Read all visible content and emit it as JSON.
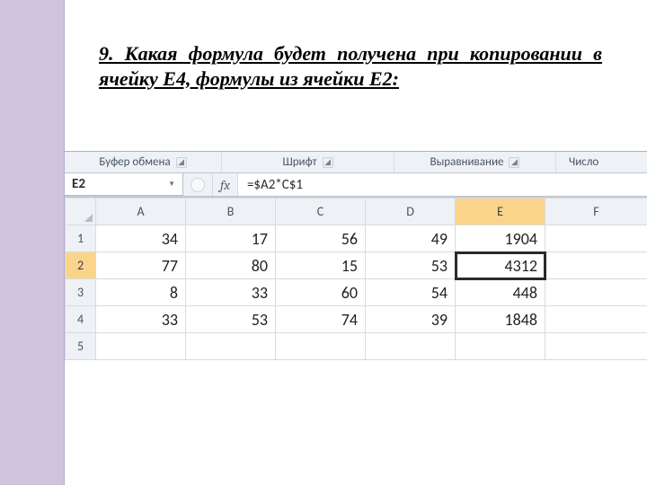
{
  "question": {
    "text": "9. Какая формула будет получена при копировании в ячейку Е4, формулы из ячейки Е2:"
  },
  "ribbon": {
    "groups": {
      "clipboard": "Буфер обмена",
      "font": "Шрифт",
      "alignment": "Выравнивание",
      "number": "Число"
    }
  },
  "formulaBar": {
    "nameBox": "E2",
    "fxLabel": "fx",
    "formula": "=$A2*C$1"
  },
  "gridHeaders": {
    "cols": [
      "A",
      "B",
      "C",
      "D",
      "E",
      "F"
    ],
    "rows": [
      "1",
      "2",
      "3",
      "4",
      "5"
    ]
  },
  "cells": {
    "r1": {
      "A": "34",
      "B": "17",
      "C": "56",
      "D": "49",
      "E": "1904"
    },
    "r2": {
      "A": "77",
      "B": "80",
      "C": "15",
      "D": "53",
      "E": "4312"
    },
    "r3": {
      "A": "8",
      "B": "33",
      "C": "60",
      "D": "54",
      "E": "448"
    },
    "r4": {
      "A": "33",
      "B": "53",
      "C": "74",
      "D": "39",
      "E": "1848"
    }
  },
  "activeCell": {
    "row": 2,
    "col": "E"
  }
}
